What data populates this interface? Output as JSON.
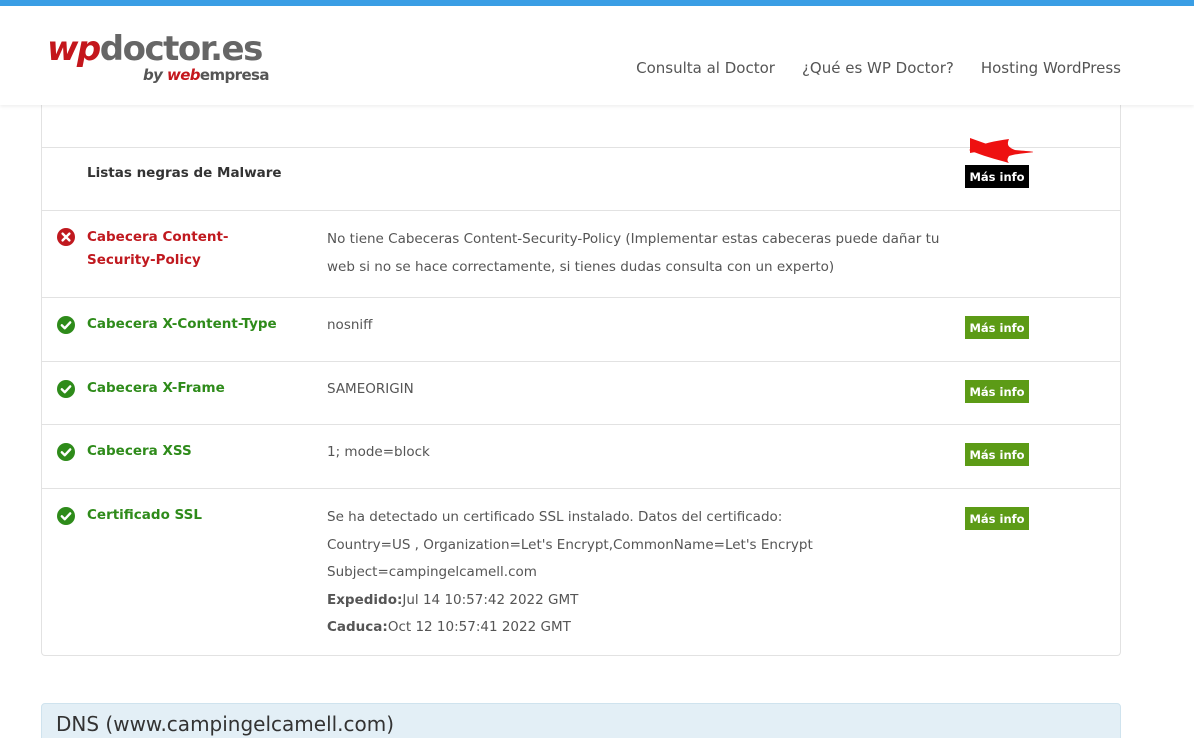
{
  "brand": {
    "logo_wp": "wp",
    "logo_doctor": "doctor.es",
    "logo_by": "by",
    "logo_web": "web",
    "logo_empresa": "empresa"
  },
  "nav": {
    "items": [
      "Consulta al Doctor",
      "¿Qué es WP Doctor?",
      "Hosting WordPress"
    ]
  },
  "checks": [
    {
      "label": "Listas negras de Malware",
      "status": "neutral",
      "value": [],
      "button": "Más info"
    },
    {
      "label": "Cabecera Content-Security-Policy",
      "status": "error",
      "icon": "error-x-icon",
      "value": [
        "No tiene Cabeceras Content-Security-Policy (Implementar estas cabeceras puede dañar tu web si no se hace correctamente, si tienes dudas consulta con un experto)"
      ],
      "button": null
    },
    {
      "label": "Cabecera X-Content-Type",
      "status": "ok",
      "icon": "check-circle-icon",
      "value": [
        "nosniff"
      ],
      "button": "Más info"
    },
    {
      "label": "Cabecera X-Frame",
      "status": "ok",
      "icon": "check-circle-icon",
      "value": [
        "SAMEORIGIN"
      ],
      "button": "Más info"
    },
    {
      "label": "Cabecera XSS",
      "status": "ok",
      "icon": "check-circle-icon",
      "value": [
        "1; mode=block"
      ],
      "button": "Más info"
    },
    {
      "label": "Certificado SSL",
      "status": "ok",
      "icon": "check-circle-icon",
      "value": [
        "Se ha detectado un certificado SSL instalado. Datos del certificado:",
        "Country=US , Organization=Let's Encrypt,CommonName=Let's Encrypt",
        "Subject=campingelcamell.com"
      ],
      "expedido_label": "Expedido:",
      "expedido_value": "Jul 14 10:57:42 2022 GMT",
      "caduca_label": "Caduca:",
      "caduca_value": "Oct 12 10:57:41 2022 GMT",
      "button": "Más info"
    }
  ],
  "dns": {
    "title": "DNS (www.campingelcamell.com)"
  },
  "colors": {
    "accent": "#3a9ee5",
    "error": "#c0191f",
    "ok": "#2e8b1a",
    "button_green": "#5c9b16",
    "annotation_arrow": "#ee1111"
  }
}
